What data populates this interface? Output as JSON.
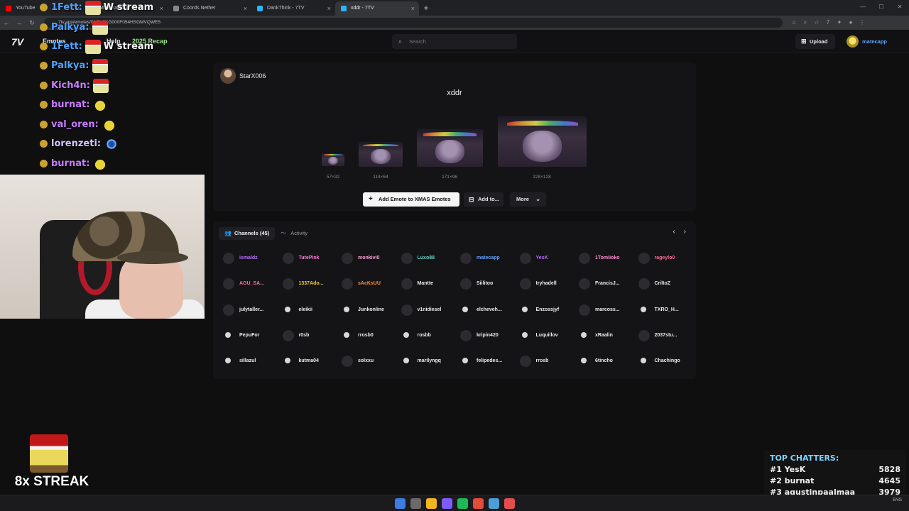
{
  "browser": {
    "tabs": [
      {
        "label": "YouTube",
        "fav": "#ff0000",
        "active": false
      },
      {
        "label": "Minecraft App",
        "fav": "#6aa84f",
        "active": false
      },
      {
        "label": "Coords Nether",
        "fav": "#888888",
        "active": false
      },
      {
        "label": "DankThink - 7TV",
        "fav": "#29b6f6",
        "active": false
      },
      {
        "label": "xddr - 7TV",
        "fav": "#29b6f6",
        "active": true
      }
    ],
    "url": "7tv.app/emotes/01GY2KG000F054HSGMVQWE5"
  },
  "nav": {
    "emotes": "Emotes",
    "help": "Help",
    "recap": "2025 Recap",
    "search_placeholder": "Search",
    "upload": "Upload",
    "username": "matecapp"
  },
  "emote": {
    "owner": "StarX006",
    "name": "xddr",
    "sizes": [
      "57×32",
      "114×64",
      "171×96",
      "228×128"
    ],
    "add_button": "Add Emote to XMAS Emotes",
    "add_to": "Add to...",
    "more": "More"
  },
  "channels": {
    "tab_channels": "Channels (45)",
    "tab_activity": "Activity",
    "list": [
      {
        "name": "ismaldz",
        "color": "#b96bff"
      },
      {
        "name": "TutePink",
        "color": "#ff7ad9"
      },
      {
        "name": "monkivi0",
        "color": "#ff9fd5"
      },
      {
        "name": "Luxo88",
        "color": "#58d6c9"
      },
      {
        "name": "matecapp",
        "color": "#5fa0ff"
      },
      {
        "name": "YesK",
        "color": "#b96bff"
      },
      {
        "name": "1Tomiioko",
        "color": "#ff8bd0"
      },
      {
        "name": "rageylo0",
        "color": "#ff6b9a"
      },
      {
        "name": "AGU_SA...",
        "color": "#ff6b9a"
      },
      {
        "name": "1337Ado...",
        "color": "#f3c64a"
      },
      {
        "name": "sAcKsUU",
        "color": "#ff8a3a"
      },
      {
        "name": "Mantte",
        "color": "#ececec"
      },
      {
        "name": "Siilitoo",
        "color": "#ececec"
      },
      {
        "name": "tryhadell",
        "color": "#ececec"
      },
      {
        "name": "FrancisJ...",
        "color": "#ececec"
      },
      {
        "name": "CriltoZ",
        "color": "#ececec"
      },
      {
        "name": "julytaller...",
        "color": "#ececec"
      },
      {
        "name": "eleikii",
        "color": "#ececec"
      },
      {
        "name": "Junkonline",
        "color": "#ececec"
      },
      {
        "name": "v1nidiesel",
        "color": "#ececec"
      },
      {
        "name": "elcheveh...",
        "color": "#ececec"
      },
      {
        "name": "Enzossjyf",
        "color": "#ececec"
      },
      {
        "name": "marcoss...",
        "color": "#ececec"
      },
      {
        "name": "TXRO_H...",
        "color": "#ececec"
      },
      {
        "name": "PepuFor",
        "color": "#ececec"
      },
      {
        "name": "r0sb",
        "color": "#ececec"
      },
      {
        "name": "rrosb0",
        "color": "#ececec"
      },
      {
        "name": "rosbb",
        "color": "#ececec"
      },
      {
        "name": "kripin420",
        "color": "#ececec"
      },
      {
        "name": "Luquillov",
        "color": "#ececec"
      },
      {
        "name": "xRaalin",
        "color": "#ececec"
      },
      {
        "name": "2037stu...",
        "color": "#ececec"
      },
      {
        "name": "sillazul",
        "color": "#ececec"
      },
      {
        "name": "kutma04",
        "color": "#ececec"
      },
      {
        "name": "solxxu",
        "color": "#ececec"
      },
      {
        "name": "marilyngq",
        "color": "#ececec"
      },
      {
        "name": "felipedes...",
        "color": "#ececec"
      },
      {
        "name": "rrosb",
        "color": "#ececec"
      },
      {
        "name": "6tincho",
        "color": "#ececec"
      },
      {
        "name": "Chachingo",
        "color": "#ececec"
      }
    ]
  },
  "chat": [
    {
      "user": "1Fett:",
      "msg": "W stream",
      "color": "#4fa3ff",
      "emote": "santa"
    },
    {
      "user": "Palkya:",
      "msg": "",
      "color": "#4fa3ff",
      "emote": "santa"
    },
    {
      "user": "1Fett:",
      "msg": "W stream",
      "color": "#4fa3ff",
      "emote": "santa"
    },
    {
      "user": "Palkya:",
      "msg": "",
      "color": "#4fa3ff",
      "emote": "santa"
    },
    {
      "user": "Kich4n:",
      "msg": "",
      "color": "#c77dff",
      "emote": "santa"
    },
    {
      "user": "burnat:",
      "msg": "",
      "color": "#c77dff",
      "emote": "angry"
    },
    {
      "user": "val_oren:",
      "msg": "",
      "color": "#c77dff",
      "emote": "angry"
    },
    {
      "user": "lorenzeti:",
      "msg": "",
      "color": "#d6c6ff",
      "emote": "sunny"
    },
    {
      "user": "burnat:",
      "msg": "",
      "color": "#c77dff",
      "emote": "angry"
    }
  ],
  "streak": "8x STREAK",
  "top_chatters": {
    "title": "TOP CHATTERS:",
    "rows": [
      {
        "rank": "#1",
        "name": "YesK",
        "count": "5828"
      },
      {
        "rank": "#2",
        "name": "burnat",
        "count": "4645"
      },
      {
        "rank": "#3",
        "name": "agustinpaalmaa",
        "count": "3979"
      }
    ]
  },
  "taskbar": {
    "colors": [
      "#3d7ce0",
      "#6a6a6a",
      "#f3b61f",
      "#7c5cff",
      "#1db954",
      "#e34b3b",
      "#4a9fd6",
      "#e24d4d"
    ],
    "lang": "ENG"
  }
}
